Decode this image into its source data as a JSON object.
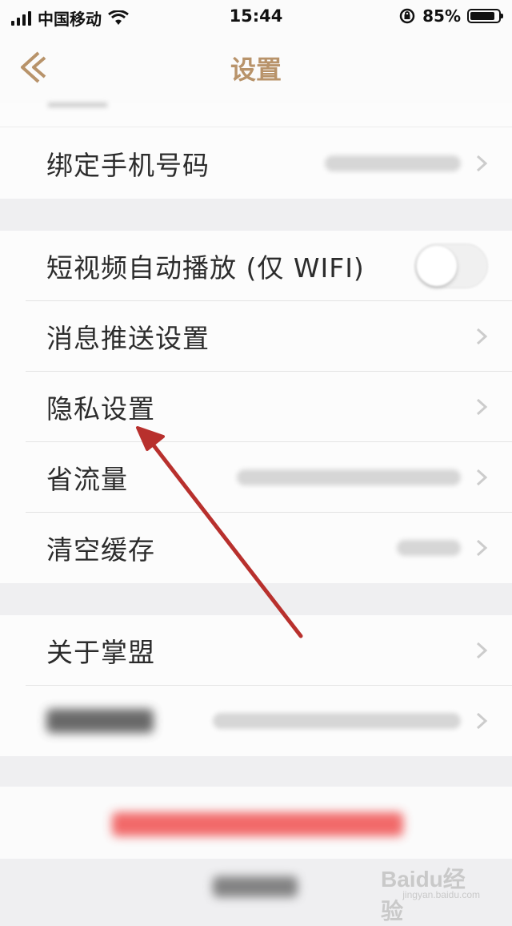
{
  "status_bar": {
    "carrier": "中国移动",
    "time": "15:44",
    "battery": "85%",
    "battery_level": 0.85
  },
  "nav": {
    "title": "设置"
  },
  "rows": {
    "bind_phone": "绑定手机号码",
    "autoplay": "短视频自动播放 (仅 WIFI)",
    "autoplay_on": false,
    "push": "消息推送设置",
    "privacy": "隐私设置",
    "data_saver": "省流量",
    "clear_cache": "清空缓存",
    "about": "关于掌盟"
  },
  "watermark": {
    "brand": "Baidu经验",
    "sub": "jingyan.baidu.com"
  },
  "colors": {
    "accent": "#b8936a",
    "annotation_arrow": "#b8302d",
    "logout_red": "#f05a5a"
  }
}
